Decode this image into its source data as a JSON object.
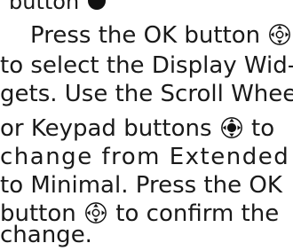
{
  "fragment_top": "button",
  "lines": [
    "Press the OK button",
    "to select the Display Wid-",
    "gets. Use the Scroll Wheel",
    "or Keypad buttons",
    "to",
    "change from Extended",
    "to Minimal. Press the OK",
    "button",
    "to confirm the",
    "change."
  ],
  "icons": {
    "ok": "ok-button-icon",
    "scroll": "scroll-wheel-icon",
    "dot": "filled-dot-icon"
  }
}
